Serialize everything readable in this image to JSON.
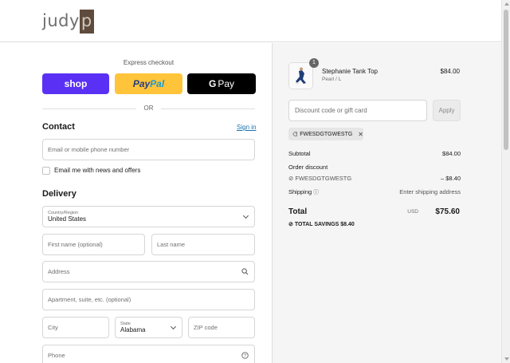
{
  "brand": {
    "logo_main": "judy",
    "logo_box": "p"
  },
  "express": {
    "title": "Express checkout",
    "shop_label": "shop",
    "paypal_pay": "Pay",
    "paypal_pal": "Pal",
    "gpay_g": "G",
    "gpay_label": "Pay",
    "or_label": "OR"
  },
  "contact": {
    "heading": "Contact",
    "signin_label": "Sign in",
    "email_placeholder": "Email or mobile phone number",
    "news_label": "Email me with news and offers"
  },
  "delivery": {
    "heading": "Delivery",
    "country_label": "Country/Region",
    "country_value": "United States",
    "first_name_placeholder": "First name (optional)",
    "last_name_placeholder": "Last name",
    "address_placeholder": "Address",
    "apartment_placeholder": "Apartment, suite, etc. (optional)",
    "city_placeholder": "City",
    "state_label": "State",
    "state_value": "Alabama",
    "zip_placeholder": "ZIP code",
    "phone_placeholder": "Phone"
  },
  "summary": {
    "product_qty": "1",
    "product_name": "Stephanie Tank Top",
    "product_variant": "Pearl / L",
    "product_price": "$84.00",
    "discount_placeholder": "Discount code or gift card",
    "apply_label": "Apply",
    "applied_code": "FWESDGTGWESTG",
    "subtotal_label": "Subtotal",
    "subtotal_value": "$84.00",
    "order_discount_label": "Order discount",
    "discount_code": "FWESDGTGWESTG",
    "discount_value": "– $8.40",
    "shipping_label": "Shipping",
    "shipping_value": "Enter shipping address",
    "total_label": "Total",
    "currency": "USD",
    "total_value": "$75.60",
    "savings_label": "TOTAL SAVINGS",
    "savings_value": "$8.40"
  },
  "colors": {
    "shop": "#5a31f4",
    "paypal": "#ffc439",
    "gpay": "#000000",
    "link": "#1773b0"
  }
}
